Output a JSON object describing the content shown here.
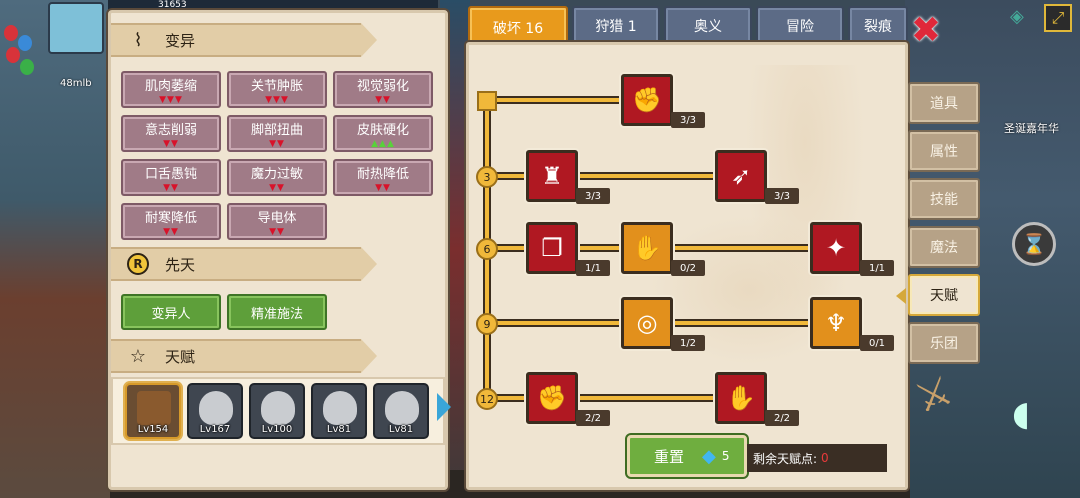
{
  "hud": {
    "hp_value": "31653",
    "memory": "48mlb"
  },
  "map_label": "圣诞嘉年华",
  "sections": {
    "mutation": {
      "title": "变异",
      "icon": "dna-icon"
    },
    "innate": {
      "title": "先天",
      "icon": "r-badge-icon"
    },
    "talent": {
      "title": "天赋",
      "icon": "star-icon"
    }
  },
  "mutations": [
    {
      "name": "肌肉萎缩",
      "arrows": "▼▼▼",
      "dir": "down"
    },
    {
      "name": "关节肿胀",
      "arrows": "▼▼▼",
      "dir": "down"
    },
    {
      "name": "视觉弱化",
      "arrows": "▼▼",
      "dir": "down"
    },
    {
      "name": "意志削弱",
      "arrows": "▼▼",
      "dir": "down"
    },
    {
      "name": "脚部扭曲",
      "arrows": "▼▼",
      "dir": "down"
    },
    {
      "name": "皮肤硬化",
      "arrows": "▲▲▲",
      "dir": "up"
    },
    {
      "name": "口舌愚钝",
      "arrows": "▼▼",
      "dir": "down"
    },
    {
      "name": "魔力过敏",
      "arrows": "▼▼",
      "dir": "down"
    },
    {
      "name": "耐热降低",
      "arrows": "▼▼",
      "dir": "down"
    },
    {
      "name": "耐寒降低",
      "arrows": "▼▼",
      "dir": "down"
    },
    {
      "name": "导电体",
      "arrows": "▼▼",
      "dir": "down"
    }
  ],
  "innate": [
    "变异人",
    "精准施法"
  ],
  "characters": [
    {
      "level": "Lv154",
      "selected": true
    },
    {
      "level": "Lv167",
      "selected": false
    },
    {
      "level": "Lv100",
      "selected": false
    },
    {
      "level": "Lv81",
      "selected": false
    },
    {
      "level": "Lv81",
      "selected": false
    }
  ],
  "top_tabs": [
    "破坏 16",
    "狩猎 1",
    "奥义",
    "冒险",
    "裂痕"
  ],
  "side_tabs": [
    "道具",
    "属性",
    "技能",
    "魔法",
    "天赋",
    "乐团"
  ],
  "active_side_tab": "天赋",
  "tiers": [
    "3",
    "6",
    "9",
    "12"
  ],
  "nodes": [
    {
      "name": "arm-wrestle-icon",
      "count": "3/3",
      "color": "red"
    },
    {
      "name": "muscle-body-icon",
      "count": "3/3",
      "color": "red"
    },
    {
      "name": "arrow-shot-icon",
      "count": "3/3",
      "color": "red"
    },
    {
      "name": "card-swap-icon",
      "count": "1/1",
      "color": "red"
    },
    {
      "name": "fist-bump-icon",
      "count": "0/2",
      "color": "orange"
    },
    {
      "name": "slash-strike-icon",
      "count": "1/1",
      "color": "red"
    },
    {
      "name": "ripple-ring-icon",
      "count": "1/2",
      "color": "orange"
    },
    {
      "name": "claw-wings-icon",
      "count": "0/1",
      "color": "orange"
    },
    {
      "name": "raised-fist-icon",
      "count": "2/2",
      "color": "red"
    },
    {
      "name": "power-fist-icon",
      "count": "2/2",
      "color": "red"
    }
  ],
  "reset": {
    "label": "重置",
    "gems": "5"
  },
  "remaining_points": {
    "label": "剩余天赋点:",
    "value": "0"
  },
  "colors": {
    "accent": "#e89a1c",
    "red_node": "#b01822",
    "orange_node": "#e2901c",
    "mutation": "#a07b87",
    "innate": "#5e9f3a"
  }
}
